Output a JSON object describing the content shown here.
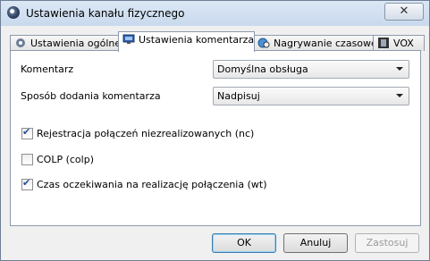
{
  "window": {
    "title": "Ustawienia kanału fizycznego",
    "close_label": "✕"
  },
  "tabs": [
    {
      "label": "Ustawienia ogólne",
      "icon": "gear-icon",
      "active": false
    },
    {
      "label": "Ustawienia komentarza",
      "icon": "monitor-icon",
      "active": true
    },
    {
      "label": "Nagrywanie czasowe",
      "icon": "globe-clock-icon",
      "active": false
    },
    {
      "label": "VOX",
      "icon": "film-icon",
      "active": false
    }
  ],
  "form": {
    "comment_label": "Komentarz",
    "comment_value": "Domyślna obsługa",
    "add_method_label": "Sposób dodania komentarza",
    "add_method_value": "Nadpisuj"
  },
  "checkboxes": [
    {
      "label": "Rejestracja połączeń niezrealizowanych (nc)",
      "checked": true
    },
    {
      "label": "COLP (colp)",
      "checked": false
    },
    {
      "label": "Czas oczekiwania na realizację połączenia (wt)",
      "checked": true
    }
  ],
  "buttons": {
    "ok": "OK",
    "cancel": "Anuluj",
    "apply": "Zastosuj"
  }
}
